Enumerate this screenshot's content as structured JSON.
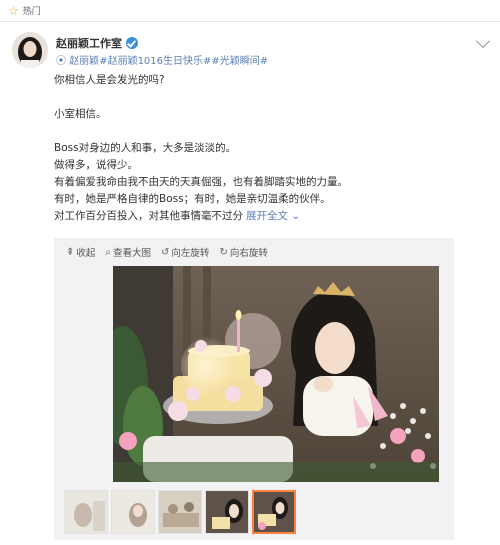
{
  "topbar": {
    "label": "热门",
    "icon": "star-icon"
  },
  "user": {
    "name": "赵丽颖工作室",
    "verified": true
  },
  "tags": [
    "赵丽颖",
    "#赵丽颖1016生日快乐#",
    "#光颖瞬间#"
  ],
  "post": {
    "lines": [
      "你相信人是会发光的吗?",
      "",
      "小室相信。",
      "",
      "Boss对身边的人和事，大多是淡淡的。",
      "做得多，说得少。",
      "有着偏爱我命由我不由天的天真倔强，也有着脚踏实地的力量。",
      "有时，她是严格自律的Boss；有时，她是亲切温柔的伙伴。",
      "对工作百分百投入，对其他事情毫不过分"
    ],
    "expand": "展开全文"
  },
  "toolbar": {
    "collapse": "收起",
    "view_large": "查看大图",
    "rotate_left": "向左旋转",
    "rotate_right": "向右旋转"
  },
  "thumbnails": {
    "count": 5,
    "active_index": 4
  }
}
